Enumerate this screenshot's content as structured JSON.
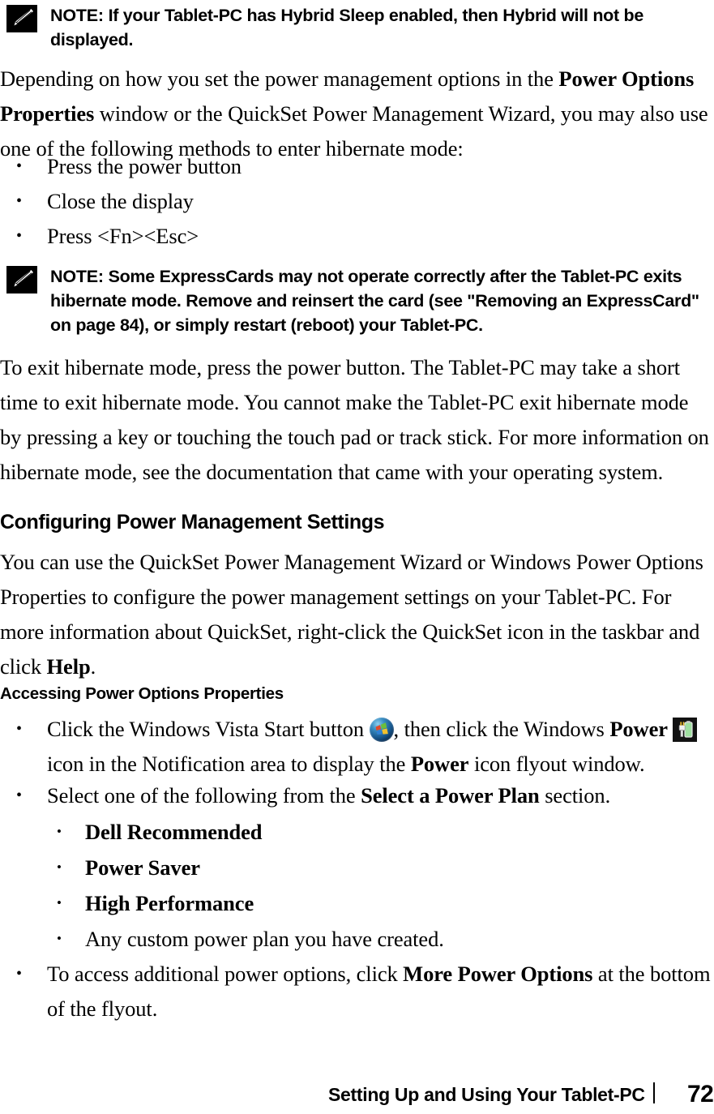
{
  "notes": [
    {
      "icon": "note-pencil-icon",
      "label": "NOTE:",
      "text_parts": [
        {
          "t": " If your Tablet-PC has ",
          "bold": false
        },
        {
          "t": "Hybrid Sleep",
          "bold": true
        },
        {
          "t": " enabled, then ",
          "bold": false
        },
        {
          "t": "Hybrid",
          "bold": true
        },
        {
          "t": " will not be displayed.",
          "bold": false
        }
      ]
    },
    {
      "icon": "note-pencil-icon",
      "label": "NOTE:",
      "text_parts": [
        {
          "t": " Some ExpressCards may not operate correctly after the Tablet-PC exits hibernate mode. Remove and reinsert the card (see \"Removing an ExpressCard\" on page 84), or simply restart (reboot) your Tablet-PC.",
          "bold": false
        }
      ]
    }
  ],
  "paragraphs": {
    "intro": [
      {
        "t": "Depending on how you set the power management options in the ",
        "bold": false
      },
      {
        "t": "Power Options Properties",
        "bold": true
      },
      {
        "t": " window or the QuickSet Power Management Wizard, you may also use one of the following methods to enter hibernate mode:",
        "bold": false
      }
    ],
    "exit_hibernate": [
      {
        "t": "To exit hibernate mode, press the power button. The Tablet-PC may take a short time to exit hibernate mode. You cannot make the Tablet-PC exit hibernate mode by pressing a key or touching the touch pad or track stick. For more information on hibernate mode, see the documentation that came with your operating system.",
        "bold": false
      }
    ],
    "quickset": [
      {
        "t": "You can use the QuickSet Power Management Wizard or Windows Power Options Properties to configure the power management settings on your Tablet-PC. For more information about QuickSet, right-click the QuickSet icon in the taskbar and click ",
        "bold": false
      },
      {
        "t": "Help",
        "bold": true
      },
      {
        "t": ".",
        "bold": false
      }
    ]
  },
  "headings": {
    "configuring": "Configuring Power Management Settings",
    "accessing": "Accessing Power Options Properties"
  },
  "lists": {
    "hibernate_methods": [
      "Press the power button",
      "Close the display",
      "Press <Fn><Esc>"
    ],
    "click_start": [
      {
        "t": "Click the Windows Vista Start button ",
        "bold": false
      },
      {
        "icon": "windows-vista-start-orb-icon"
      },
      {
        "t": ", then click the Windows ",
        "bold": false
      },
      {
        "t": "Power",
        "bold": true
      },
      {
        "t": " ",
        "bold": false
      },
      {
        "icon": "power-tray-icon"
      },
      {
        "t": " icon in the Notification area to display the ",
        "bold": false
      },
      {
        "t": "Power",
        "bold": true
      },
      {
        "t": " icon flyout window.",
        "bold": false
      }
    ],
    "select_plan": [
      {
        "t": "Select one of the following from the ",
        "bold": false
      },
      {
        "t": "Select a Power Plan",
        "bold": true
      },
      {
        "t": " section.",
        "bold": false
      }
    ],
    "power_plans": [
      {
        "label": "Dell Recommended",
        "bold": true
      },
      {
        "label": "Power Saver",
        "bold": true
      },
      {
        "label": "High Performance",
        "bold": true
      },
      {
        "label": "Any custom power plan you have created.",
        "bold": false
      }
    ],
    "more_power_options": [
      {
        "t": "To access additional power options, click ",
        "bold": false
      },
      {
        "t": "More Power Options",
        "bold": true
      },
      {
        "t": " at the bottom of the flyout.",
        "bold": false
      }
    ]
  },
  "footer": {
    "title": "Setting Up and Using Your Tablet-PC",
    "page_number": "72"
  },
  "colors": {
    "text": "#000000",
    "page_background": "#ffffff",
    "note_icon_background": "#000000",
    "vista_orb_blue": "#16558c",
    "flag_red": "#e04a2a",
    "flag_green": "#6cbf3a",
    "flag_blue": "#2f7fd4",
    "flag_yellow": "#f2c12e",
    "battery_green": "#9fe0a0",
    "tray_icon_background": "#121212"
  }
}
